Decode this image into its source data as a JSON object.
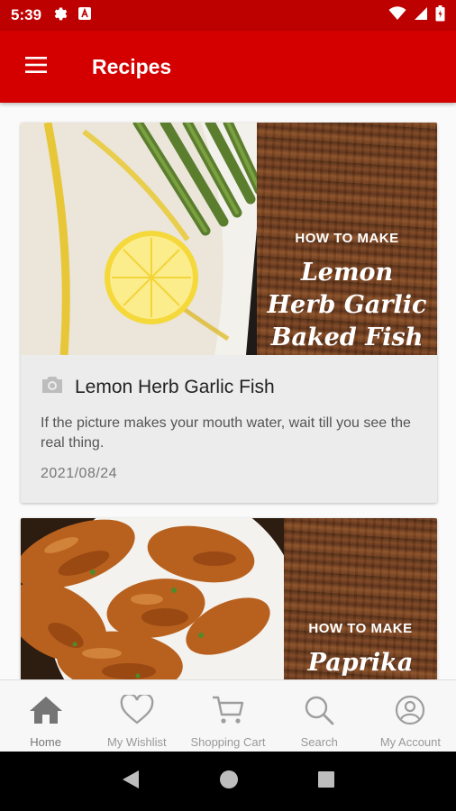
{
  "status": {
    "time": "5:39"
  },
  "app": {
    "title": "Recipes"
  },
  "cards": [
    {
      "image_heading": "HOW TO MAKE",
      "image_script": [
        "Lemon",
        "Herb Garlic",
        "Baked Fish"
      ],
      "title": "Lemon Herb Garlic Fish",
      "description": "If the picture makes your mouth water, wait till you see the real thing.",
      "date": "2021/08/24"
    },
    {
      "image_heading": "HOW TO MAKE",
      "image_script": [
        "Paprika"
      ]
    }
  ],
  "bottom_nav": [
    {
      "label": "Home",
      "icon": "home-icon",
      "active": true
    },
    {
      "label": "My Wishlist",
      "icon": "heart-icon"
    },
    {
      "label": "Shopping Cart",
      "icon": "cart-icon"
    },
    {
      "label": "Search",
      "icon": "search-icon"
    },
    {
      "label": "My Account",
      "icon": "account-icon"
    }
  ],
  "colors": {
    "status_bar": "#bd0000",
    "app_bar": "#d40000",
    "card_bg": "#ececec"
  }
}
